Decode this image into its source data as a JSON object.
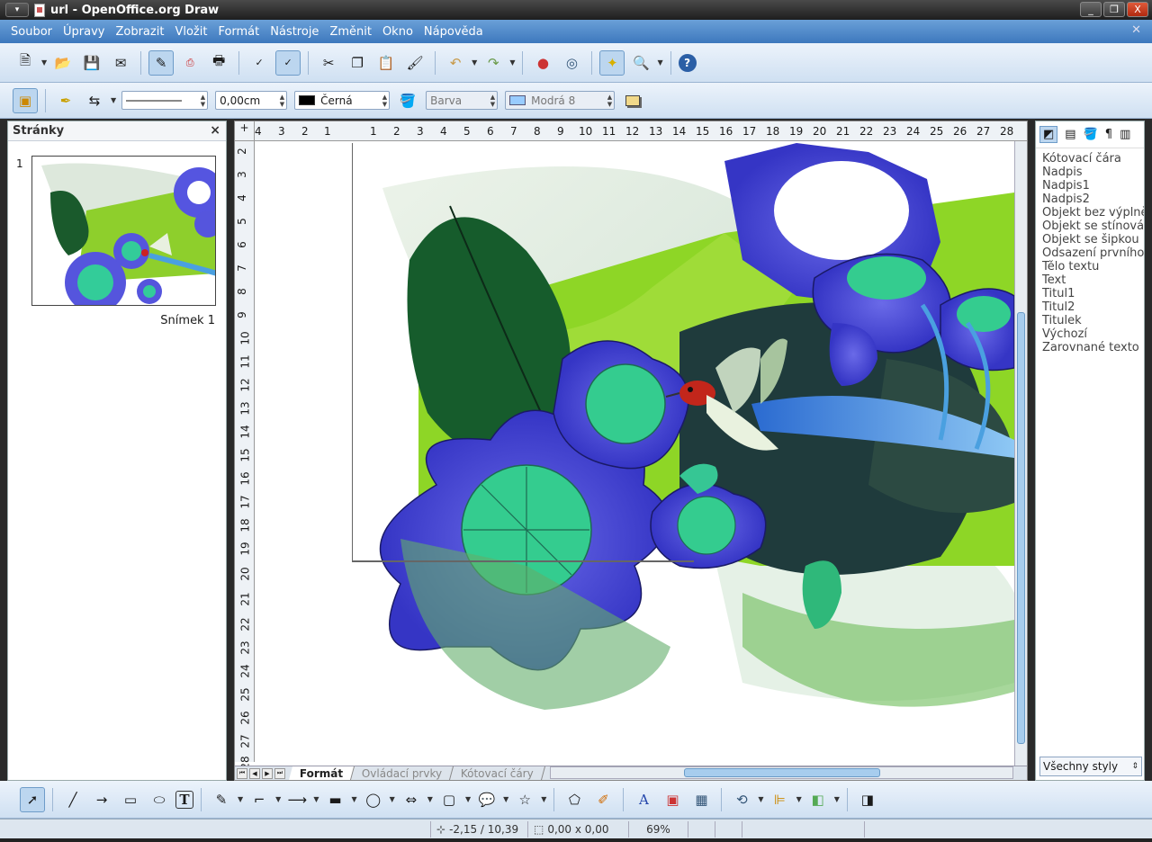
{
  "window": {
    "title": "url - OpenOffice.org Draw",
    "buttons": [
      "_",
      "❐",
      "X"
    ]
  },
  "menu": [
    "Soubor",
    "Úpravy",
    "Zobrazit",
    "Vložit",
    "Formát",
    "Nástroje",
    "Změnit",
    "Okno",
    "Nápověda"
  ],
  "line_toolbar": {
    "line_width": "0,00cm",
    "line_color": "Černá",
    "line_color_hex": "#000000",
    "fill_type": "Barva",
    "fill_color": "Modrá 8",
    "fill_color_hex": "#99ccff"
  },
  "pages_panel": {
    "title": "Stránky",
    "close": "×",
    "slides": [
      {
        "number": "1",
        "label": "Snímek 1"
      }
    ]
  },
  "ruler_h": [
    "4",
    "3",
    "2",
    "1",
    "1",
    "2",
    "3",
    "4",
    "5",
    "6",
    "7",
    "8",
    "9",
    "10",
    "11",
    "12",
    "13",
    "14",
    "15",
    "16",
    "17",
    "18",
    "19",
    "20",
    "21",
    "22",
    "23",
    "24",
    "25",
    "26",
    "27",
    "28"
  ],
  "ruler_v": [
    "2",
    "3",
    "4",
    "5",
    "6",
    "7",
    "8",
    "9",
    "10",
    "11",
    "12",
    "13",
    "14",
    "15",
    "16",
    "17",
    "18",
    "19",
    "20",
    "21",
    "22",
    "23",
    "24",
    "25",
    "26",
    "27",
    "28"
  ],
  "layer_tabs": [
    "Formát",
    "Ovládací prvky",
    "Kótovací čáry"
  ],
  "styles_panel": {
    "styles": [
      "Kótovací čára",
      "Nadpis",
      "Nadpis1",
      "Nadpis2",
      "Objekt bez výplně",
      "Objekt se stínová",
      "Objekt se šipkou",
      "Odsazení prvního",
      "Tělo textu",
      "Text",
      "Titul1",
      "Titul2",
      "Titulek",
      "Výchozí",
      "Zarovnané texto"
    ],
    "filter": "Všechny styly"
  },
  "status": {
    "position": "-2,15 / 10,39",
    "size": "0,00 x 0,00",
    "zoom": "69%"
  }
}
